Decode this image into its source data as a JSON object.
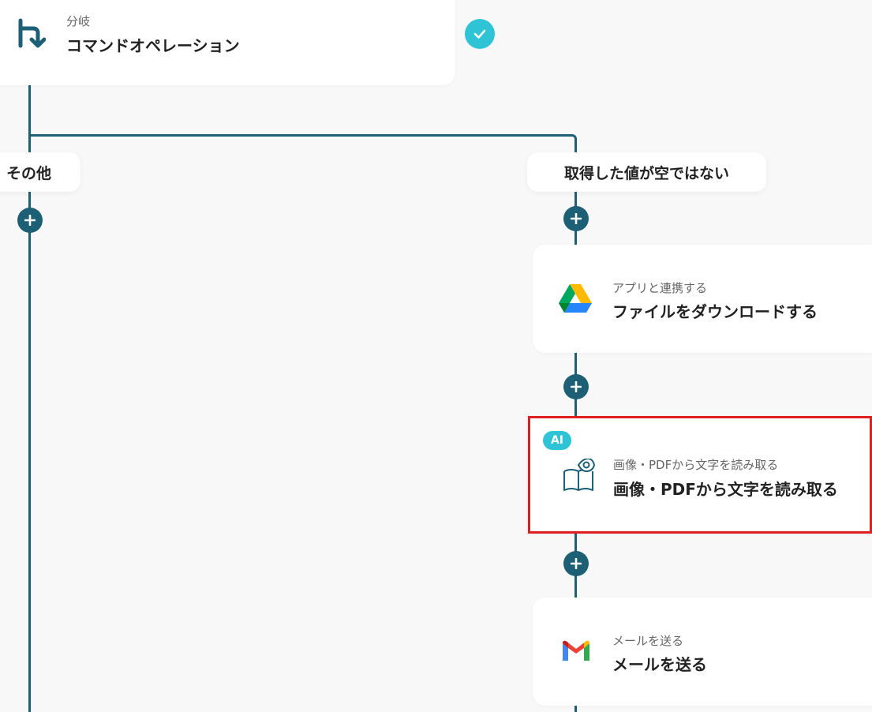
{
  "branch_card": {
    "subtitle": "分岐",
    "title": "コマンドオペレーション",
    "icon": "branch-icon",
    "status_icon": "check-icon"
  },
  "branches": {
    "left_label": "その他",
    "right_label": "取得した値が空ではない"
  },
  "steps": [
    {
      "subtitle": "アプリと連携する",
      "title": "ファイルをダウンロードする",
      "icon": "google-drive-icon"
    },
    {
      "badge": "AI",
      "subtitle": "画像・PDFから文字を読み取る",
      "title": "画像・PDFから文字を読み取る",
      "icon": "book-eye-icon",
      "highlighted": true
    },
    {
      "subtitle": "メールを送る",
      "title": "メールを送る",
      "icon": "gmail-icon"
    }
  ],
  "colors": {
    "line": "#1d5f75",
    "check": "#2ec4d6",
    "highlight": "#e02020",
    "ai_badge": "#2ec4d6"
  }
}
